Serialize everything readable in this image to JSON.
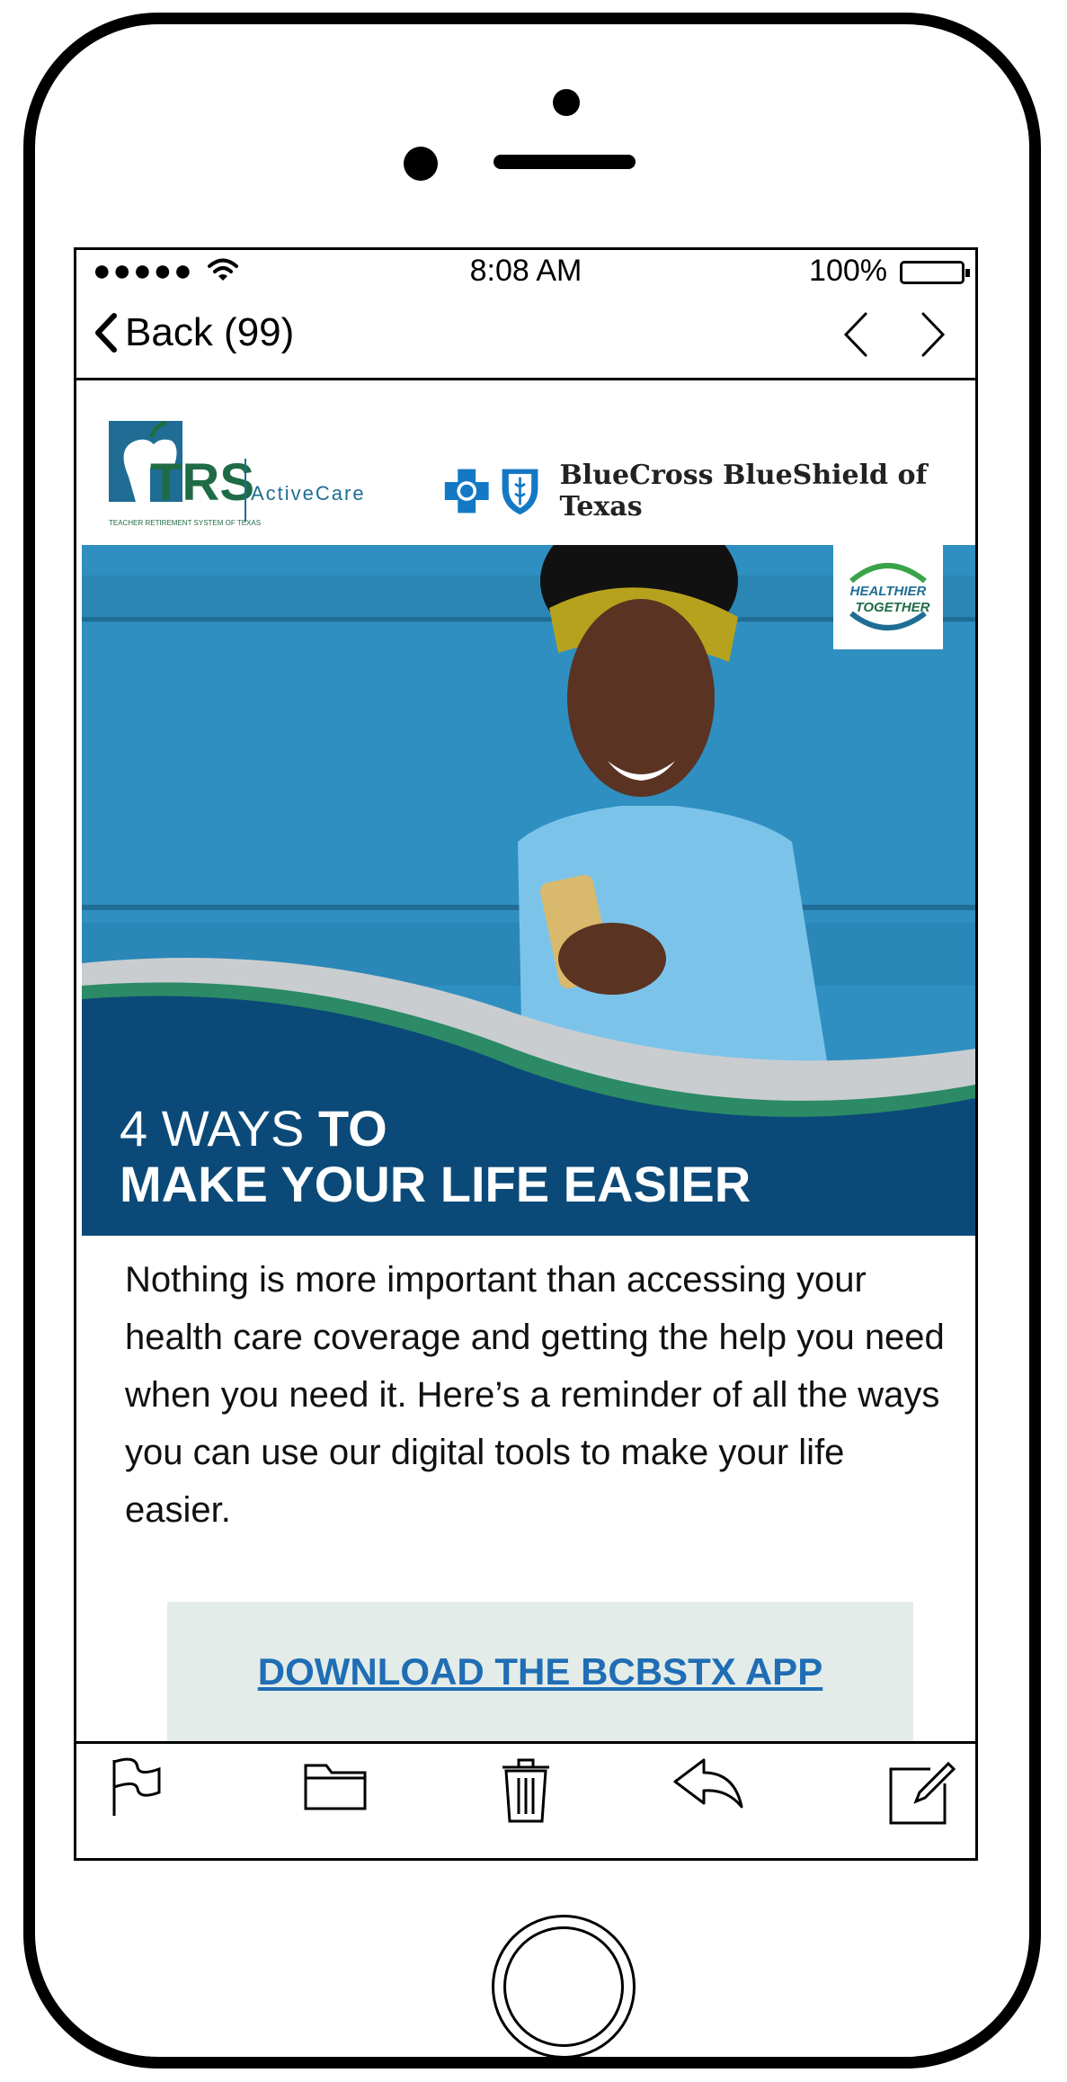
{
  "status": {
    "signal": "●●●●●",
    "time": "8:08 AM",
    "battery": "100%"
  },
  "nav": {
    "back_label": "Back (99)"
  },
  "email": {
    "logos": {
      "trs_main": "TRS",
      "trs_sub": "ActiveCare",
      "trs_caption": "TEACHER RETIREMENT SYSTEM OF TEXAS",
      "bcbs_name": "BlueCross BlueShield of Texas",
      "badge_line1": "HEALTHIER",
      "badge_line2": "TOGETHER"
    },
    "hero": {
      "title_light": "4 WAYS ",
      "title_bold": "TO",
      "title_line2": "MAKE YOUR LIFE EASIER"
    },
    "intro": "Nothing is more important than accessing your health care coverage and getting the help you need when you need it. Here’s a reminder of all the ways you can use our digital tools to make your life easier.",
    "cta_label": "DOWNLOAD THE BCBSTX APP"
  },
  "colors": {
    "hero_blue": "#2f8fc0",
    "banner_navy": "#0b4a78",
    "trs_green": "#1f6b45",
    "bcbs_blue": "#1479c4",
    "cta_bg": "#e3ece8",
    "cta_link": "#1f6db5"
  },
  "toolbar": {
    "icons": [
      "flag-icon",
      "folder-icon",
      "trash-icon",
      "reply-icon",
      "compose-icon"
    ]
  }
}
